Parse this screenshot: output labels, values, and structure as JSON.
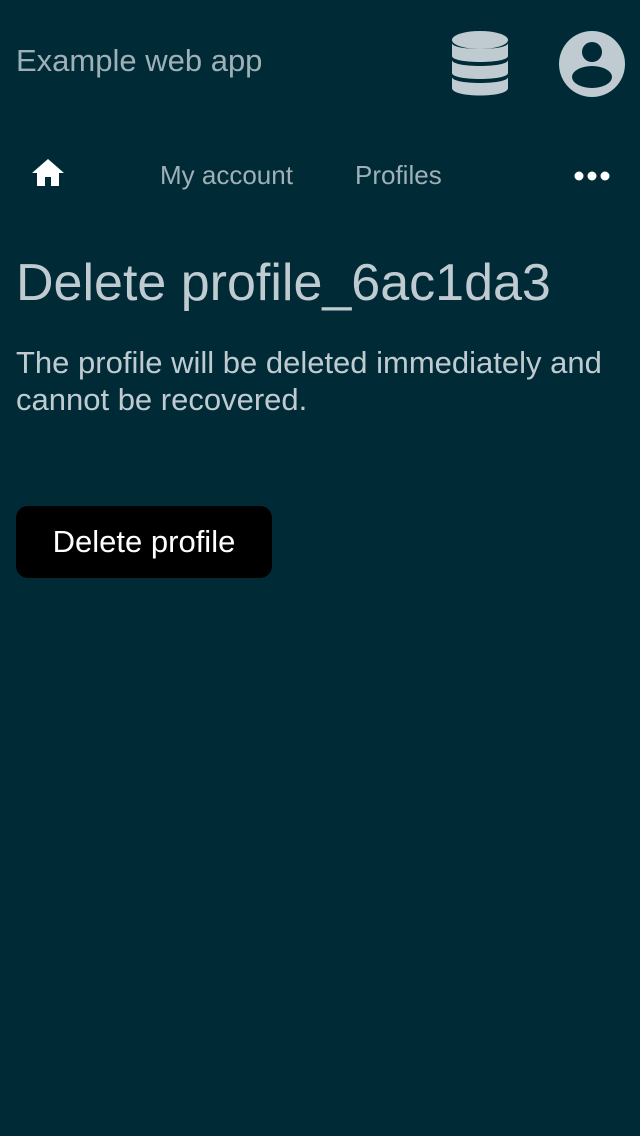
{
  "header": {
    "app_title": "Example web app",
    "icons": [
      "database-icon",
      "account-circle-icon"
    ]
  },
  "nav": {
    "home_icon": "home-icon",
    "items": [
      {
        "label": "My account"
      },
      {
        "label": "Profiles"
      }
    ],
    "more_icon": "more-horizontal-icon"
  },
  "main": {
    "title": "Delete profile_6ac1da3",
    "description": "The profile will be deleted immediately and cannot be recovered.",
    "delete_button_label": "Delete profile"
  },
  "colors": {
    "background": "#002b36",
    "text": "#bfcbd0",
    "muted_text": "#9fb0b6",
    "button_background": "#000000",
    "button_text": "#ffffff"
  }
}
